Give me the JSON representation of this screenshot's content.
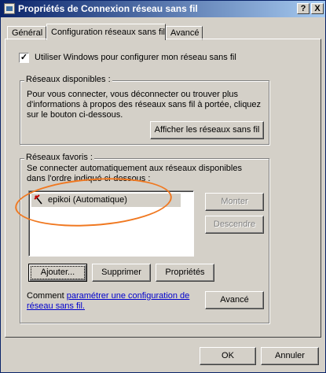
{
  "window": {
    "title": "Propriétés de Connexion réseau sans fil",
    "help_btn": "?",
    "close_btn": "X"
  },
  "tabs": [
    {
      "label": "Général",
      "active": false
    },
    {
      "label": "Configuration réseaux sans fil",
      "active": true
    },
    {
      "label": "Avancé",
      "active": false
    }
  ],
  "use_windows": {
    "checked": true,
    "check_glyph": "✓",
    "label": "Utiliser Windows pour configurer mon réseau sans fil"
  },
  "available": {
    "title": "Réseaux disponibles :",
    "description": "Pour vous connecter, vous déconnecter ou trouver plus d'informations à propos des réseaux sans fil à portée, cliquez sur le bouton ci-dessous.",
    "button": "Afficher les réseaux sans fil"
  },
  "favorites": {
    "title": "Réseaux favoris :",
    "description": "Se connecter automatiquement aux réseaux disponibles dans l'ordre indiqué ci-dessous :",
    "items": [
      {
        "label": "epikoi (Automatique)",
        "icon": "wireless-network-icon"
      }
    ],
    "move_up": "Monter",
    "move_down": "Descendre",
    "add": "Ajouter...",
    "remove": "Supprimer",
    "properties": "Propriétés"
  },
  "comment": {
    "prefix": "Comment ",
    "link": "paramétrer une configuration de réseau sans fil.",
    "suffix": ""
  },
  "advanced_button": "Avancé",
  "footer": {
    "ok": "OK",
    "cancel": "Annuler"
  },
  "colors": {
    "titlebar_start": "#0a246a",
    "titlebar_end": "#a6caf0",
    "dialog_face": "#d4d0c8",
    "link": "#0000cc",
    "annotation": "#f07820"
  }
}
